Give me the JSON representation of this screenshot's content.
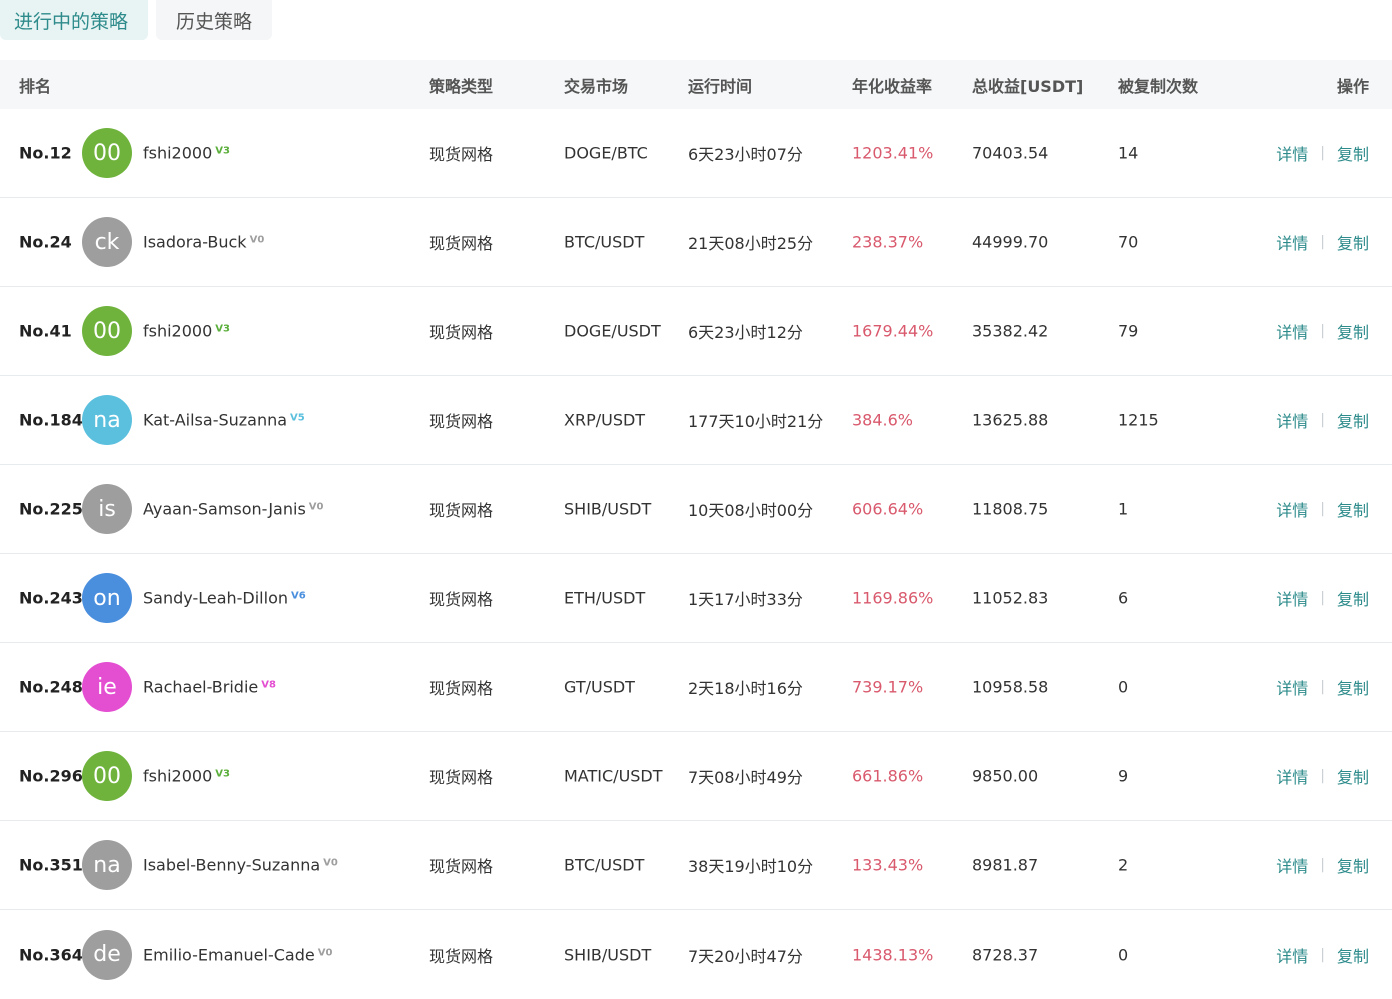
{
  "tabs": [
    {
      "label": "进行中的策略",
      "active": true
    },
    {
      "label": "历史策略",
      "active": false
    }
  ],
  "table": {
    "headers": {
      "rank": "排名",
      "type": "策略类型",
      "market": "交易市场",
      "runtime": "运行时间",
      "apy": "年化收益率",
      "total": "总收益[USDT]",
      "copies": "被复制次数",
      "ops": "操作"
    },
    "rows": [
      {
        "rank": "No.12",
        "avatar": "00",
        "avatar_color": "#6fb33d",
        "user": "fshi2000",
        "badge": "V3",
        "badge_color": "#5aae3a",
        "type": "现货网格",
        "market": "DOGE/BTC",
        "runtime": "6天23小时07分",
        "apy": "1203.41%",
        "total": "70403.54",
        "copies": "14",
        "op_detail": "详情",
        "op_copy": "复制"
      },
      {
        "rank": "No.24",
        "avatar": "ck",
        "avatar_color": "#9e9e9e",
        "user": "Isadora-Buck",
        "badge": "V0",
        "badge_color": "#9e9e9e",
        "type": "现货网格",
        "market": "BTC/USDT",
        "runtime": "21天08小时25分",
        "apy": "238.37%",
        "total": "44999.70",
        "copies": "70",
        "op_detail": "详情",
        "op_copy": "复制"
      },
      {
        "rank": "No.41",
        "avatar": "00",
        "avatar_color": "#6fb33d",
        "user": "fshi2000",
        "badge": "V3",
        "badge_color": "#5aae3a",
        "type": "现货网格",
        "market": "DOGE/USDT",
        "runtime": "6天23小时12分",
        "apy": "1679.44%",
        "total": "35382.42",
        "copies": "79",
        "op_detail": "详情",
        "op_copy": "复制"
      },
      {
        "rank": "No.184",
        "avatar": "na",
        "avatar_color": "#5bc0de",
        "user": "Kat-Ailsa-Suzanna",
        "badge": "V5",
        "badge_color": "#5bc0de",
        "type": "现货网格",
        "market": "XRP/USDT",
        "runtime": "177天10小时21分",
        "apy": "384.6%",
        "total": "13625.88",
        "copies": "1215",
        "op_detail": "详情",
        "op_copy": "复制"
      },
      {
        "rank": "No.225",
        "avatar": "is",
        "avatar_color": "#9e9e9e",
        "user": "Ayaan-Samson-Janis",
        "badge": "V0",
        "badge_color": "#9e9e9e",
        "type": "现货网格",
        "market": "SHIB/USDT",
        "runtime": "10天08小时00分",
        "apy": "606.64%",
        "total": "11808.75",
        "copies": "1",
        "op_detail": "详情",
        "op_copy": "复制"
      },
      {
        "rank": "No.243",
        "avatar": "on",
        "avatar_color": "#4a8ede",
        "user": "Sandy-Leah-Dillon",
        "badge": "V6",
        "badge_color": "#4a8ede",
        "type": "现货网格",
        "market": "ETH/USDT",
        "runtime": "1天17小时33分",
        "apy": "1169.86%",
        "total": "11052.83",
        "copies": "6",
        "op_detail": "详情",
        "op_copy": "复制"
      },
      {
        "rank": "No.248",
        "avatar": "ie",
        "avatar_color": "#e44ed1",
        "user": "Rachael-Bridie",
        "badge": "V8",
        "badge_color": "#e44ed1",
        "type": "现货网格",
        "market": "GT/USDT",
        "runtime": "2天18小时16分",
        "apy": "739.17%",
        "total": "10958.58",
        "copies": "0",
        "op_detail": "详情",
        "op_copy": "复制"
      },
      {
        "rank": "No.296",
        "avatar": "00",
        "avatar_color": "#6fb33d",
        "user": "fshi2000",
        "badge": "V3",
        "badge_color": "#5aae3a",
        "type": "现货网格",
        "market": "MATIC/USDT",
        "runtime": "7天08小时49分",
        "apy": "661.86%",
        "total": "9850.00",
        "copies": "9",
        "op_detail": "详情",
        "op_copy": "复制"
      },
      {
        "rank": "No.351",
        "avatar": "na",
        "avatar_color": "#9e9e9e",
        "user": "Isabel-Benny-Suzanna",
        "badge": "V0",
        "badge_color": "#9e9e9e",
        "type": "现货网格",
        "market": "BTC/USDT",
        "runtime": "38天19小时10分",
        "apy": "133.43%",
        "total": "8981.87",
        "copies": "2",
        "op_detail": "详情",
        "op_copy": "复制"
      },
      {
        "rank": "No.364",
        "avatar": "de",
        "avatar_color": "#9e9e9e",
        "user": "Emilio-Emanuel-Cade",
        "badge": "V0",
        "badge_color": "#9e9e9e",
        "type": "现货网格",
        "market": "SHIB/USDT",
        "runtime": "7天20小时47分",
        "apy": "1438.13%",
        "total": "8728.37",
        "copies": "0",
        "op_detail": "详情",
        "op_copy": "复制"
      }
    ]
  }
}
